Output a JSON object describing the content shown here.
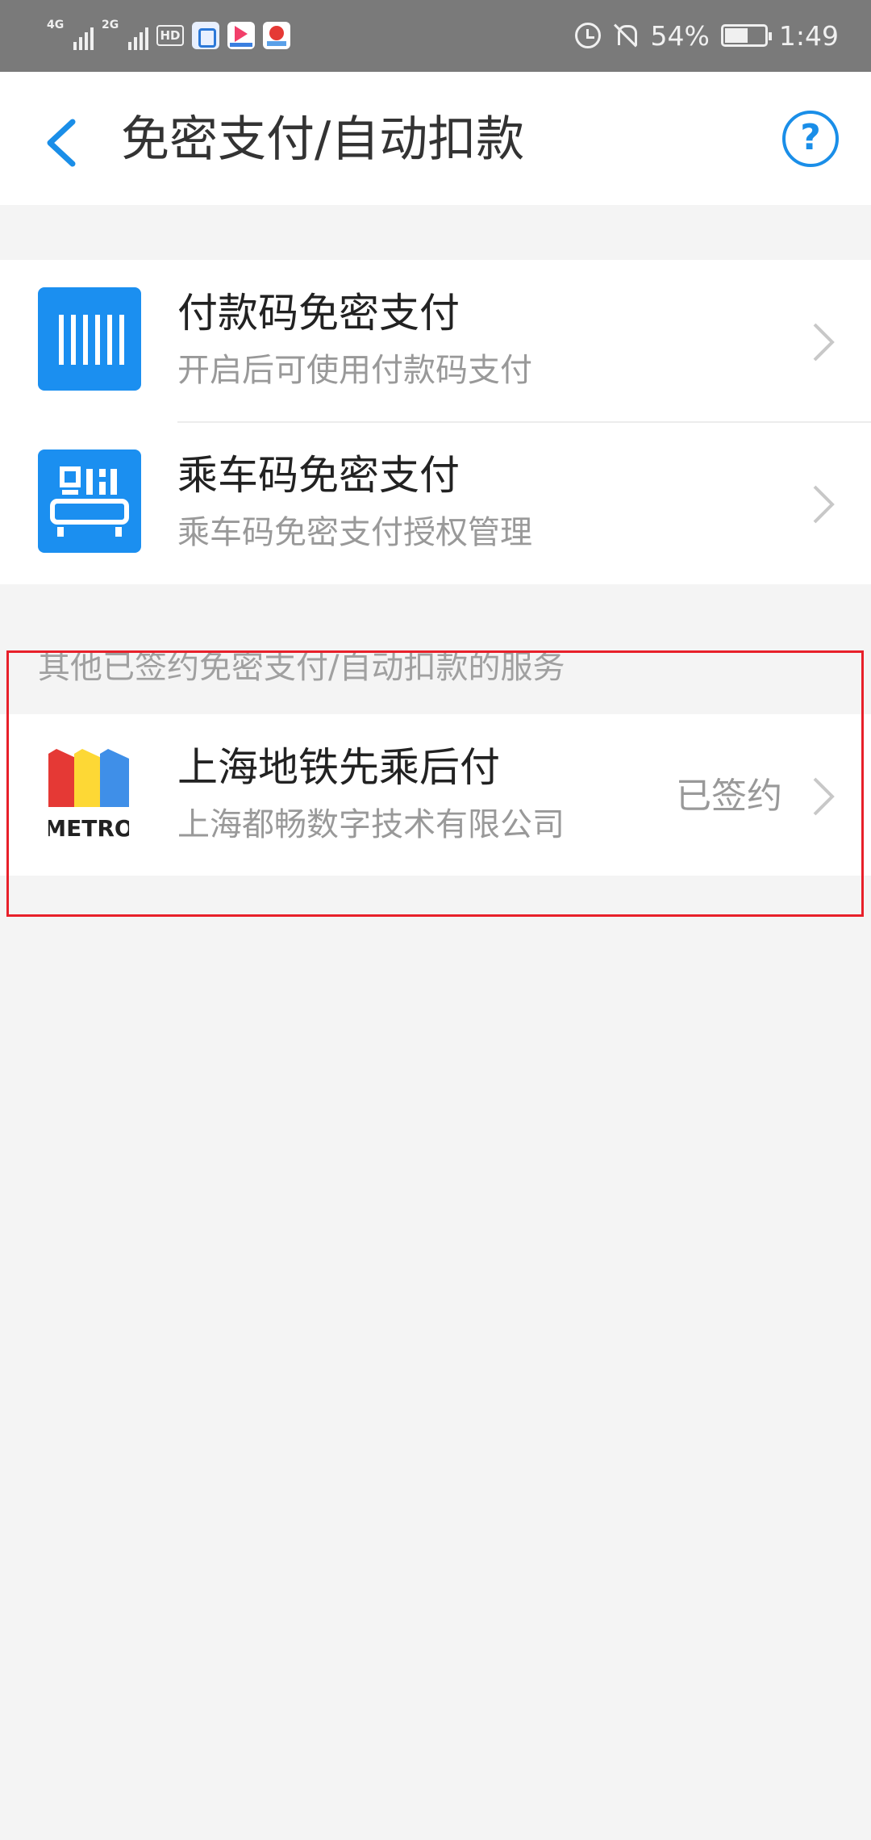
{
  "status_bar": {
    "signal1_label": "4G",
    "signal2_label": "2G",
    "hd_label": "HD",
    "app_icons": [
      "shopping-app-icon",
      "youku-app-icon",
      "map-app-icon"
    ],
    "alarm_icon": "alarm-icon",
    "mute_icon": "bell-off-icon",
    "battery_percent": "54%",
    "time": "1:49"
  },
  "header": {
    "title": "免密支付/自动扣款",
    "back_icon": "chevron-left-icon",
    "help_label": "?"
  },
  "main": {
    "items": [
      {
        "title": "付款码免密支付",
        "subtitle": "开启后可使用付款码支付",
        "icon": "barcode-icon"
      },
      {
        "title": "乘车码免密支付",
        "subtitle": "乘车码免密支付授权管理",
        "icon": "bus-qr-icon"
      }
    ],
    "section_label": "其他已签约免密支付/自动扣款的服务",
    "services": [
      {
        "title": "上海地铁先乘后付",
        "subtitle": "上海都畅数字技术有限公司",
        "status": "已签约",
        "logo_text": "METRO"
      }
    ]
  },
  "colors": {
    "accent": "#1a8ee8",
    "icon_bg": "#1b8ff0",
    "highlight": "#e8202a",
    "status_bar": "#7a7a7a"
  }
}
